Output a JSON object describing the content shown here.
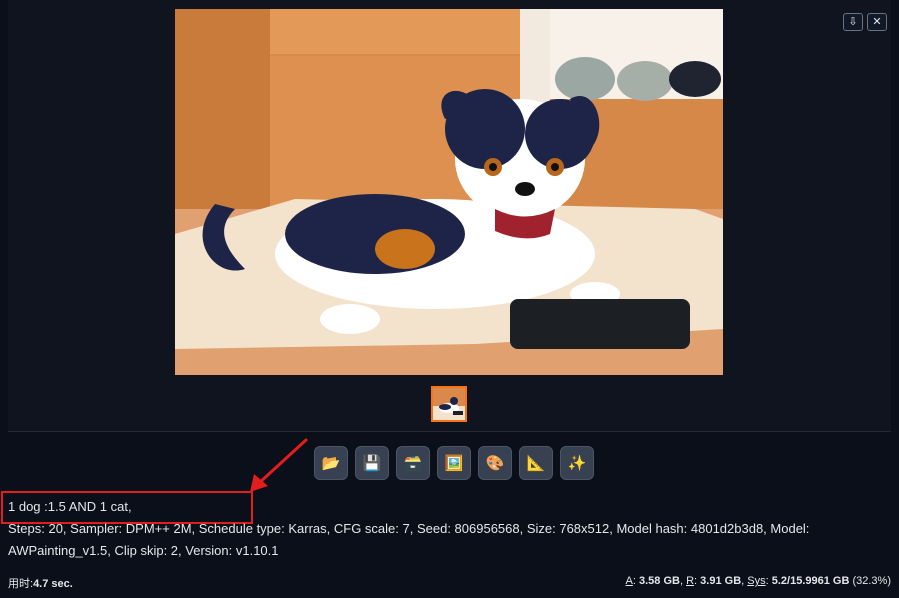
{
  "gallery": {
    "download_icon": "⇩",
    "close_icon": "✕"
  },
  "toolbar": {
    "buttons": [
      {
        "name": "open-folder-button",
        "icon": "📂"
      },
      {
        "name": "save-button",
        "icon": "💾"
      },
      {
        "name": "zip-button",
        "icon": "🗃️"
      },
      {
        "name": "send-to-img2img-button",
        "icon": "🖼️"
      },
      {
        "name": "send-to-inpaint-button",
        "icon": "🎨"
      },
      {
        "name": "send-to-extras-button",
        "icon": "📐"
      },
      {
        "name": "upscale-button",
        "icon": "✨"
      }
    ]
  },
  "prompt": "1 dog :1.5 AND 1 cat,",
  "params": "Steps: 20, Sampler: DPM++ 2M, Schedule type: Karras, CFG scale: 7, Seed: 806956568, Size: 768x512, Model hash: 4801d2b3d8, Model: AWPainting_v1.5, Clip skip: 2, Version: v1.10.1",
  "footer": {
    "time_label": "用时:",
    "time_value": "4.7 sec.",
    "a_label": "A",
    "a_value": "3.58 GB",
    "r_label": "R",
    "r_value": "3.91 GB",
    "sys_label": "Sys",
    "sys_value": "5.2/15.9961 GB",
    "sys_percent": "(32.3%)"
  },
  "colors": {
    "highlight_box": "#e11d1d",
    "thumb_border": "#f97316",
    "background": "#0b0f19"
  }
}
